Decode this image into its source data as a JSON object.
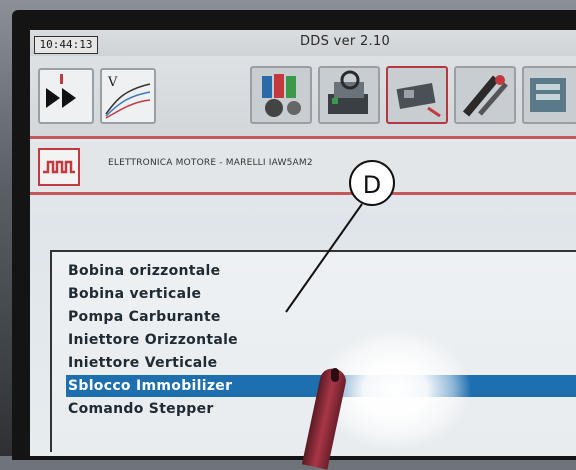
{
  "app": {
    "clock": "10:44:13",
    "title": "DDS ver 2.10"
  },
  "toolbar": {
    "buttons": [
      {
        "name": "play-icon",
        "label": ""
      },
      {
        "name": "voltage-graph-icon",
        "label": "V"
      },
      {
        "name": "components-icon",
        "label": ""
      },
      {
        "name": "diagnostic-icon",
        "label": ""
      },
      {
        "name": "ecu-icon",
        "label": ""
      },
      {
        "name": "tool-icon",
        "label": ""
      },
      {
        "name": "partial-icon",
        "label": ""
      }
    ]
  },
  "section": {
    "title": "ELETTRONICA MOTORE - MARELLI IAW5AM2"
  },
  "list": {
    "items": [
      {
        "label": "Bobina orizzontale",
        "selected": false
      },
      {
        "label": "Bobina verticale",
        "selected": false
      },
      {
        "label": "Pompa Carburante",
        "selected": false
      },
      {
        "label": "Iniettore Orizzontale",
        "selected": false
      },
      {
        "label": "Iniettore Verticale",
        "selected": false
      },
      {
        "label": "Sblocco Immobilizer",
        "selected": true
      },
      {
        "label": "Comando Stepper",
        "selected": false
      }
    ]
  },
  "callout": {
    "label": "D"
  },
  "colors": {
    "accent_red": "#c7565a",
    "selection_blue": "#1d6fb0"
  }
}
